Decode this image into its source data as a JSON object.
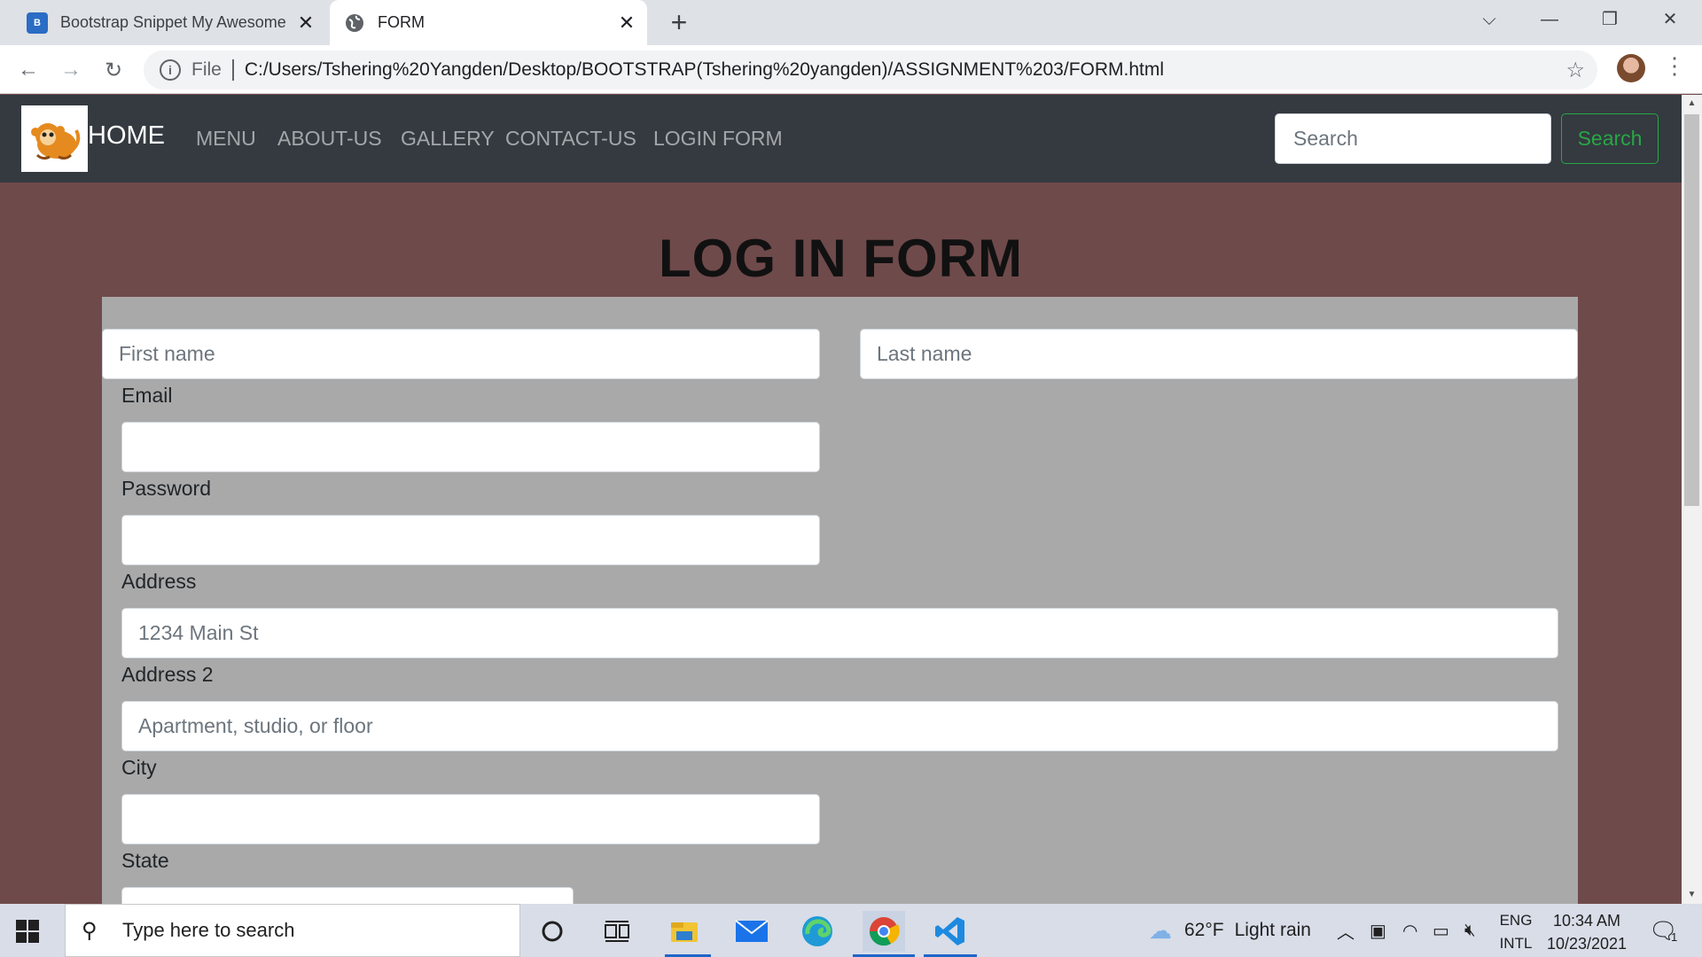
{
  "browser": {
    "tabs": [
      {
        "label": "Bootstrap Snippet My Awesome",
        "favicon": "B"
      },
      {
        "label": "FORM"
      }
    ],
    "new_tab": "+",
    "address": {
      "file_label": "File",
      "url": "C:/Users/Tshering%20Yangden/Desktop/BOOTSTRAP(Tshering%20yangden)/ASSIGNMENT%203/FORM.html"
    }
  },
  "navbar": {
    "brand": "HOME",
    "links": [
      "MENU",
      "ABOUT-US",
      "GALLERY",
      "CONTACT-US",
      "LOGIN FORM"
    ],
    "search_placeholder": "Search",
    "search_button": "Search"
  },
  "form": {
    "title": "LOG IN FORM",
    "first_name_placeholder": "First name",
    "last_name_placeholder": "Last name",
    "email_label": "Email",
    "password_label": "Password",
    "address_label": "Address",
    "address_placeholder": "1234 Main St",
    "address2_label": "Address 2",
    "address2_placeholder": "Apartment, studio, or floor",
    "city_label": "City",
    "state_label": "State"
  },
  "taskbar": {
    "search_placeholder": "Type here to search",
    "weather_temp": "62°F",
    "weather_text": "Light rain",
    "lang_top": "ENG",
    "lang_bottom": "INTL",
    "time": "10:34 AM",
    "date": "10/23/2021",
    "notification_count": "1"
  },
  "colors": {
    "page_bg": "#6f4a4b",
    "navbar_bg": "#343a40",
    "form_bg": "#a9a9a9",
    "success": "#28a745"
  }
}
